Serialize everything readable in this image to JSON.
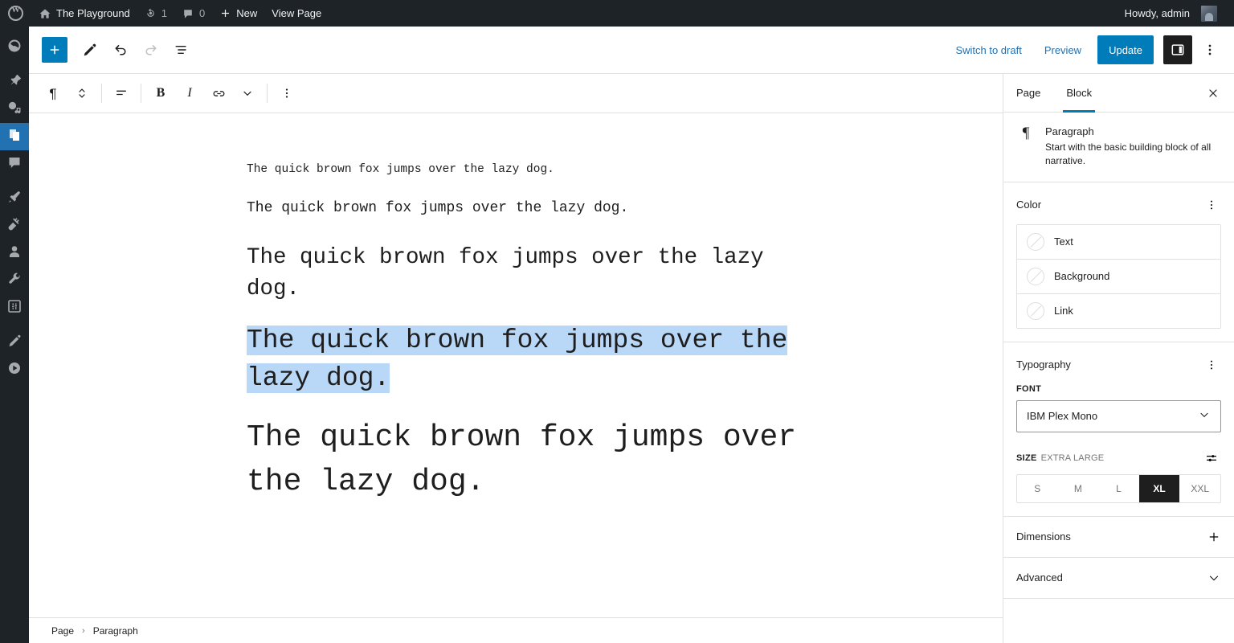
{
  "adminbar": {
    "logo_icon": "wordpress-logo-icon",
    "site_icon": "home-icon",
    "site_name": "The Playground",
    "revisions_icon": "update-revision-icon",
    "revisions_count": "1",
    "comments_icon": "comment-bubble-icon",
    "comments_count": "0",
    "new_icon": "plus-icon",
    "new_label": "New",
    "view_page_label": "View Page",
    "howdy_label": "Howdy, admin",
    "avatar_icon": "user-avatar"
  },
  "adminmenu": {
    "items": [
      {
        "name": "dashboard",
        "icon": "dashboard-icon",
        "active": false
      },
      {
        "name": "posts",
        "icon": "pin-icon",
        "active": false
      },
      {
        "name": "media",
        "icon": "media-icon",
        "active": false
      },
      {
        "name": "pages",
        "icon": "pages-icon",
        "active": true
      },
      {
        "name": "comments",
        "icon": "comment-icon",
        "active": false
      },
      {
        "name": "appearance",
        "icon": "paintbrush-icon",
        "active": false
      },
      {
        "name": "plugins",
        "icon": "plugin-plug-icon",
        "active": false
      },
      {
        "name": "users",
        "icon": "user-icon",
        "active": false
      },
      {
        "name": "tools",
        "icon": "wrench-icon",
        "active": false
      },
      {
        "name": "settings",
        "icon": "settings-sliders-icon",
        "active": false
      },
      {
        "name": "editor",
        "icon": "pencil-icon",
        "active": false
      },
      {
        "name": "playground",
        "icon": "play-circle-icon",
        "active": false
      }
    ]
  },
  "header": {
    "add_block_icon": "plus-icon",
    "add_block_label": "+",
    "tools_icon": "pencil-tool-icon",
    "undo_icon": "undo-arrow-icon",
    "redo_icon": "redo-arrow-icon",
    "list_view_icon": "document-outline-icon",
    "switch_to_draft_label": "Switch to draft",
    "preview_label": "Preview",
    "update_label": "Update",
    "sidebar_toggle_icon": "sidebar-panel-icon",
    "options_icon": "three-dots-vertical-icon"
  },
  "block_toolbar": {
    "block_type_icon": "paragraph-pilcrow-icon",
    "block_type_glyph": "¶",
    "movers_icon": "up-down-chevrons-icon",
    "align_icon": "align-text-icon",
    "bold_label": "B",
    "bold_icon": "bold-icon",
    "italic_label": "I",
    "italic_icon": "italic-icon",
    "link_icon": "link-chain-icon",
    "more_formats_icon": "chevron-down-icon",
    "options_icon": "three-dots-vertical-icon"
  },
  "content": {
    "paragraphs": [
      {
        "text": "The quick brown fox jumps over the lazy dog.",
        "size": "s",
        "selected": false
      },
      {
        "text": "The quick brown fox jumps over the lazy dog.",
        "size": "m",
        "selected": false
      },
      {
        "text": "The quick brown fox jumps over the lazy dog.",
        "size": "l",
        "selected": false
      },
      {
        "text": "The quick brown fox jumps over the lazy dog.",
        "size": "xl",
        "selected": true
      },
      {
        "text": "The quick brown fox jumps over the lazy dog.",
        "size": "xxl",
        "selected": false
      }
    ],
    "selection_highlight_color": "#b9d7f7"
  },
  "breadcrumb": {
    "items": [
      "Page",
      "Paragraph"
    ],
    "separator": "›"
  },
  "settings": {
    "tabs": [
      {
        "label": "Page",
        "active": false
      },
      {
        "label": "Block",
        "active": true
      }
    ],
    "close_icon": "close-x-icon",
    "blockcard": {
      "icon": "paragraph-pilcrow-icon",
      "glyph": "¶",
      "title": "Paragraph",
      "description": "Start with the basic building block of all narrative."
    },
    "color": {
      "title": "Color",
      "menu_icon": "three-dots-vertical-icon",
      "rows": [
        {
          "label": "Text",
          "swatch_icon": "no-color-slash-icon"
        },
        {
          "label": "Background",
          "swatch_icon": "no-color-slash-icon"
        },
        {
          "label": "Link",
          "swatch_icon": "no-color-slash-icon"
        }
      ]
    },
    "typography": {
      "title": "Typography",
      "menu_icon": "three-dots-vertical-icon",
      "font_label": "FONT",
      "font_value": "IBM Plex Mono",
      "font_chevron_icon": "chevron-down-icon",
      "size_label": "SIZE",
      "size_value": "EXTRA LARGE",
      "size_settings_icon": "sliders-icon",
      "sizes": [
        {
          "label": "S",
          "active": false
        },
        {
          "label": "M",
          "active": false
        },
        {
          "label": "L",
          "active": false
        },
        {
          "label": "XL",
          "active": true
        },
        {
          "label": "XXL",
          "active": false
        }
      ]
    },
    "dimensions": {
      "title": "Dimensions",
      "icon": "plus-icon"
    },
    "advanced": {
      "title": "Advanced",
      "icon": "chevron-down-icon"
    }
  },
  "colors": {
    "wp_blue": "#2271b1",
    "editor_blue": "#007cba",
    "admin_dark": "#1d2327",
    "selection": "#b9d7f7"
  }
}
